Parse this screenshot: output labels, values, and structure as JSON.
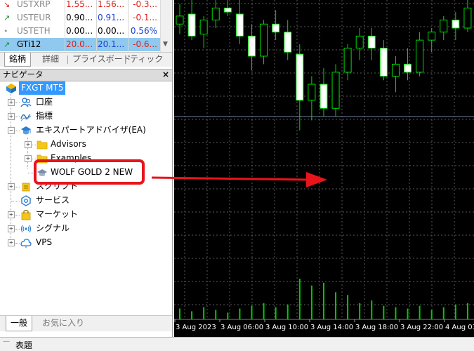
{
  "market_watch": {
    "rows": [
      {
        "arrow": "↘",
        "arrow_color": "#d9201b",
        "symbol": "USTXRP",
        "bid": "1.55...",
        "ask": "1.56...",
        "change": "-0.3...",
        "bid_color": "#d9201b",
        "ask_color": "#d9201b",
        "change_color": "#d9201b",
        "selected": false
      },
      {
        "arrow": "↗",
        "arrow_color": "#1f8a2e",
        "symbol": "USTEUR",
        "bid": "0.90...",
        "ask": "0.91...",
        "change": "-0.1...",
        "bid_color": "#000000",
        "ask_color": "#1a3fd1",
        "change_color": "#d9201b",
        "selected": false
      },
      {
        "arrow": "•",
        "arrow_color": "#9a9a9a",
        "symbol": "USTETH",
        "bid": "0.00...",
        "ask": "0.00...",
        "change": "0.56%",
        "bid_color": "#000000",
        "ask_color": "#000000",
        "change_color": "#1a3fd1",
        "selected": false
      },
      {
        "arrow": "↗",
        "arrow_color": "#1f8a2e",
        "symbol": "GTi12",
        "bid": "20.0...",
        "ask": "20.1...",
        "change": "-0.6...",
        "bid_color": "#d9201b",
        "ask_color": "#1a3fd1",
        "change_color": "#d9201b",
        "selected": true
      }
    ],
    "tabs": [
      "銘柄",
      "詳細",
      "プライスボード",
      "ティック"
    ]
  },
  "navigator": {
    "title": "ナビゲータ",
    "close": "×",
    "root": "FXGT MT5",
    "items": [
      {
        "label": "口座",
        "icon": "accounts-icon"
      },
      {
        "label": "指標",
        "icon": "indicators-icon"
      },
      {
        "label": "エキスパートアドバイザ(EA)",
        "icon": "expert-advisors-icon"
      },
      {
        "label": "Advisors",
        "icon": "folder-icon"
      },
      {
        "label": "Examples",
        "icon": "folder-icon"
      },
      {
        "label": "WOLF GOLD 2 NEW",
        "icon": "expert-hat-icon"
      },
      {
        "label": "スクリプト",
        "icon": "scripts-icon"
      },
      {
        "label": "サービス",
        "icon": "services-icon"
      },
      {
        "label": "マーケット",
        "icon": "market-bag-icon"
      },
      {
        "label": "シグナル",
        "icon": "signals-icon"
      },
      {
        "label": "VPS",
        "icon": "vps-cloud-icon"
      }
    ],
    "bottom_tabs": [
      "一般",
      "お気に入り"
    ]
  },
  "chart": {
    "x_labels": [
      "3 Aug 2023",
      "3 Aug 06:00",
      "3 Aug 10:00",
      "3 Aug 14:00",
      "3 Aug 18:00",
      "3 Aug 22:00",
      "4 Aug 03:"
    ],
    "colors": {
      "background": "#000000",
      "grid": "#5a5a5a",
      "candle": "#00dd00",
      "bull_body": "#000000",
      "bear_body": "#ffffff",
      "volume": "#00cc00",
      "axis_text": "#ffffff"
    },
    "candles": [
      {
        "o": 20.08,
        "h": 20.18,
        "l": 20.03,
        "c": 20.12
      },
      {
        "o": 20.13,
        "h": 20.2,
        "l": 20.0,
        "c": 20.02
      },
      {
        "o": 20.03,
        "h": 20.12,
        "l": 19.96,
        "c": 20.1
      },
      {
        "o": 20.1,
        "h": 20.22,
        "l": 20.06,
        "c": 20.16
      },
      {
        "o": 20.16,
        "h": 20.25,
        "l": 20.12,
        "c": 20.14
      },
      {
        "o": 20.13,
        "h": 20.2,
        "l": 19.98,
        "c": 20.02
      },
      {
        "o": 20.02,
        "h": 20.08,
        "l": 19.85,
        "c": 19.92
      },
      {
        "o": 19.92,
        "h": 20.1,
        "l": 19.88,
        "c": 20.08
      },
      {
        "o": 20.08,
        "h": 20.15,
        "l": 20.0,
        "c": 20.04
      },
      {
        "o": 20.04,
        "h": 20.1,
        "l": 19.9,
        "c": 19.94
      },
      {
        "o": 19.93,
        "h": 19.98,
        "l": 19.55,
        "c": 19.7
      },
      {
        "o": 19.7,
        "h": 19.82,
        "l": 19.6,
        "c": 19.78
      },
      {
        "o": 19.78,
        "h": 19.86,
        "l": 19.62,
        "c": 19.66
      },
      {
        "o": 19.66,
        "h": 19.88,
        "l": 19.62,
        "c": 19.84
      },
      {
        "o": 19.84,
        "h": 19.98,
        "l": 19.8,
        "c": 19.96
      },
      {
        "o": 19.96,
        "h": 20.06,
        "l": 19.9,
        "c": 20.02
      },
      {
        "o": 20.02,
        "h": 20.06,
        "l": 19.9,
        "c": 19.96
      },
      {
        "o": 19.96,
        "h": 20.0,
        "l": 19.8,
        "c": 19.82
      },
      {
        "o": 19.82,
        "h": 19.92,
        "l": 19.74,
        "c": 19.88
      },
      {
        "o": 19.88,
        "h": 19.96,
        "l": 19.8,
        "c": 19.84
      },
      {
        "o": 19.84,
        "h": 20.04,
        "l": 19.82,
        "c": 20.0
      },
      {
        "o": 20.0,
        "h": 20.06,
        "l": 19.94,
        "c": 20.04
      },
      {
        "o": 20.04,
        "h": 20.12,
        "l": 20.0,
        "c": 20.1
      },
      {
        "o": 20.1,
        "h": 20.14,
        "l": 20.0,
        "c": 20.06
      },
      {
        "o": 20.06,
        "h": 20.2,
        "l": 20.04,
        "c": 20.16
      }
    ],
    "volumes": [
      8,
      6,
      9,
      7,
      5,
      8,
      10,
      12,
      9,
      11,
      30,
      25,
      27,
      20,
      18,
      12,
      14,
      10,
      9,
      8,
      10,
      7,
      9,
      11,
      12
    ]
  },
  "annotation": {
    "color": "#e8141b"
  },
  "statusbar": {
    "label": "表題"
  }
}
